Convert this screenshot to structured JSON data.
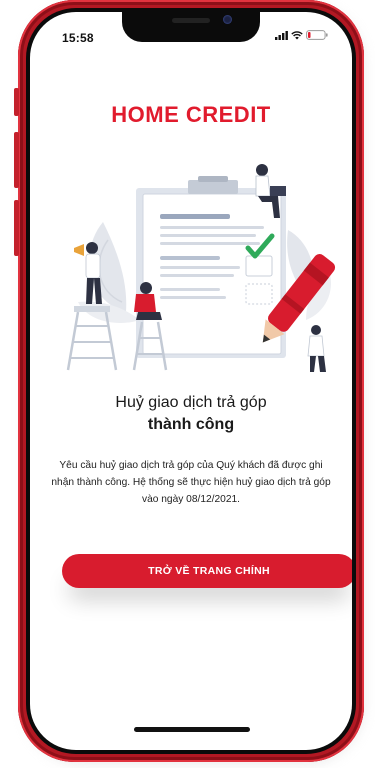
{
  "status_bar": {
    "time": "15:58"
  },
  "brand": {
    "name": "HOME CREDIT"
  },
  "result": {
    "title_line1": "Huỷ giao dịch trả góp",
    "title_line2": "thành công",
    "description": "Yêu cầu huỷ giao dịch trả góp của Quý khách đã được ghi nhận thành công. Hệ thống sẽ thực hiện huỷ giao dịch trả góp vào ngày 08/12/2021."
  },
  "cta": {
    "label": "TRỞ VỀ TRANG CHÍNH"
  },
  "colors": {
    "brand_red": "#e11b2d",
    "button_red": "#d81c2e",
    "frame_red": "#b31823"
  }
}
